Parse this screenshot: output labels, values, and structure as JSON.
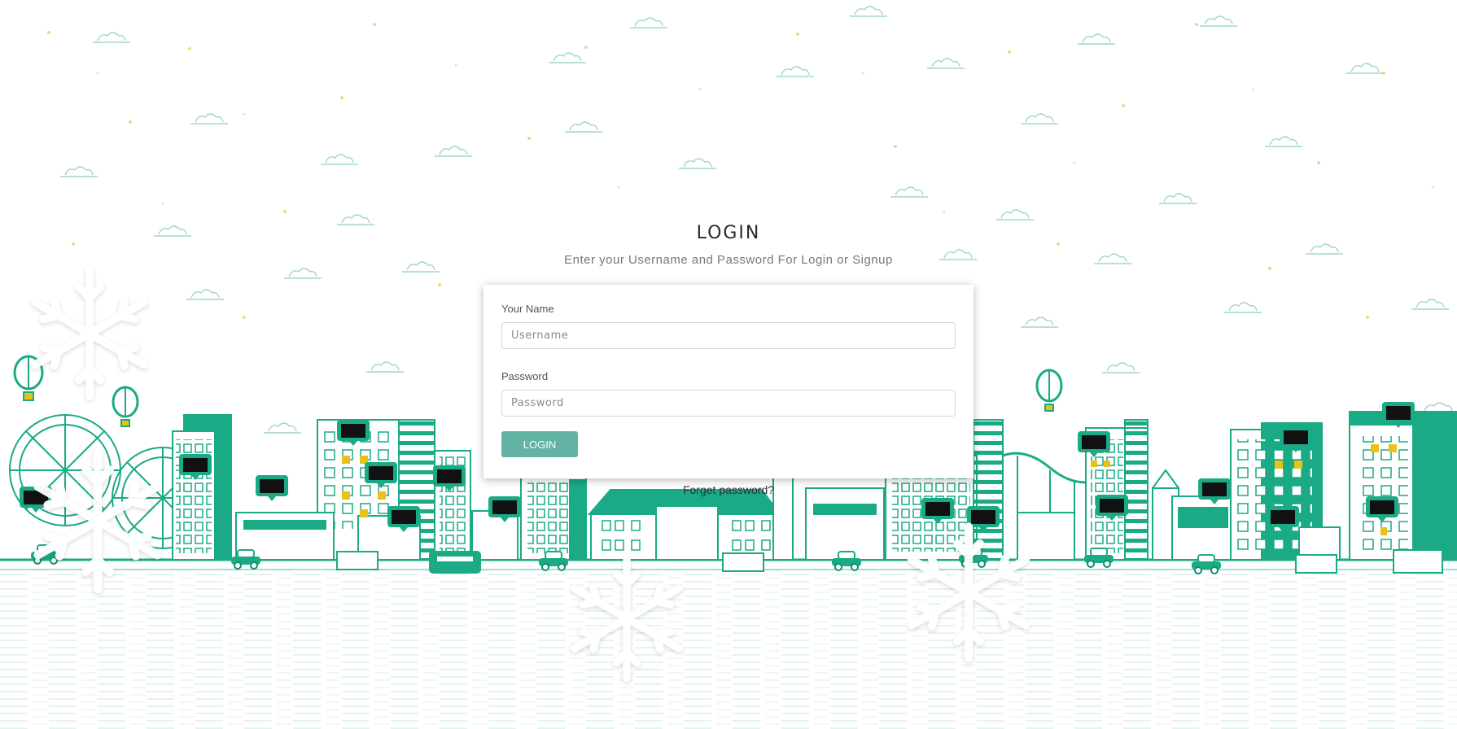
{
  "login": {
    "title": "LOGIN",
    "subtitle": "Enter your Username and Password For Login or Signup",
    "username_label": "Your Name",
    "username_placeholder": "Username",
    "password_label": "Password",
    "password_placeholder": "Password",
    "login_button": "LOGIN",
    "forget_link": "Forget password?"
  },
  "theme": {
    "accent": "#1aaa85",
    "accent_dark": "#0e8f6e",
    "button": "#62b3a4",
    "window_yellow": "#e6c21a"
  },
  "decor": {
    "icons": [
      "cloud-icon",
      "snowflake-icon",
      "hot-air-balloon-icon",
      "ferris-wheel-icon",
      "building-icon",
      "car-icon",
      "bus-icon",
      "truck-icon",
      "billboard-icon"
    ]
  }
}
